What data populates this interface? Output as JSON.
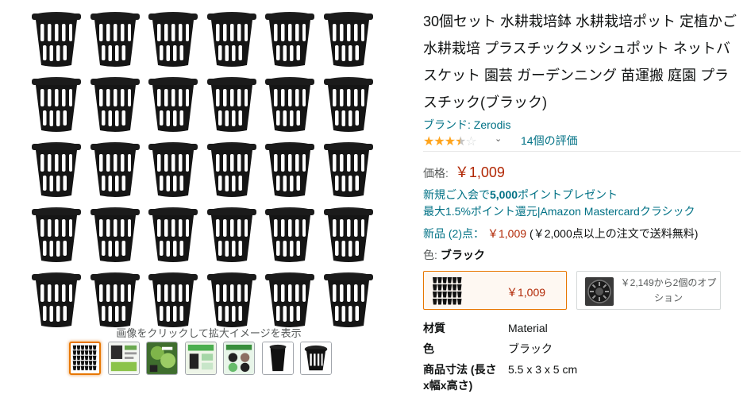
{
  "gallery": {
    "caption": "画像をクリックして拡大イメージを表示",
    "thumbnails": [
      {
        "name": "thumb-pots-grid",
        "selected": true
      },
      {
        "name": "thumb-infographic-1",
        "selected": false
      },
      {
        "name": "thumb-plants-photo",
        "selected": false
      },
      {
        "name": "thumb-infographic-2",
        "selected": false
      },
      {
        "name": "thumb-infographic-3",
        "selected": false
      },
      {
        "name": "thumb-pot-side",
        "selected": false
      },
      {
        "name": "thumb-pot-top",
        "selected": false
      }
    ]
  },
  "product": {
    "title": "30個セット 水耕栽培鉢 水耕栽培ポット 定植かご 水耕栽培 プラスチックメッシュポット ネットバスケット 園芸 ガーデンニング 苗運搬 庭園 プラスチック(ブラック)",
    "brand": "ブランド: Zerodis",
    "rating": {
      "stars": 3.5,
      "max": 5,
      "count_text": "14個の評価",
      "caret": "⌄"
    },
    "price": {
      "label": "価格:",
      "value": "￥1,009"
    },
    "promo_line1_prefix": "新規ご入会で",
    "promo_line1_bold": "5,000",
    "promo_line1_suffix": "ポイントプレゼント",
    "promo_line2": "最大1.5%ポイント還元|Amazon Mastercardクラシック",
    "offers": {
      "link": "新品 (2)点：",
      "price": "￥1,009",
      "shipping": "(￥2,000点以上の注文で送料無料)"
    },
    "color": {
      "label": "色:",
      "value": "ブラック"
    },
    "swatches": {
      "selected_price": "￥1,009",
      "other_text": "￥2,149から2個のオプション"
    },
    "specs": [
      {
        "key": "材質",
        "value": "Material"
      },
      {
        "key": "色",
        "value": "ブラック"
      },
      {
        "key": "商品寸法 (長さx幅x高さ)",
        "value": "5.5 x 3 x 5 cm"
      }
    ]
  },
  "colors": {
    "link": "#007185",
    "price": "#b12704",
    "star": "#ffa41c",
    "selected_border": "#e77600"
  }
}
